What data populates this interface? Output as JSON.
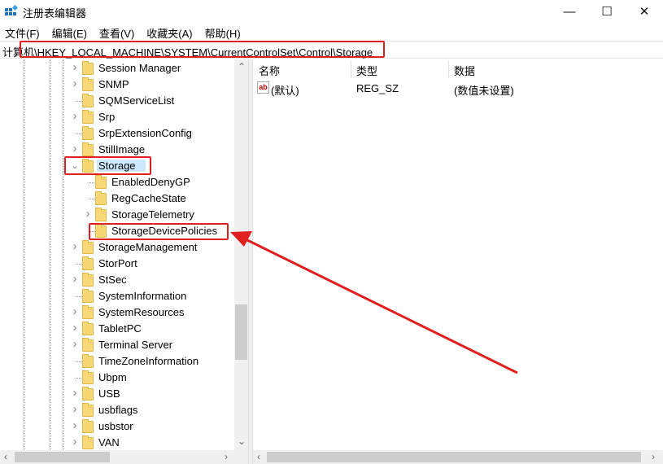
{
  "window": {
    "title": "注册表编辑器",
    "minimize": "—",
    "maximize": "☐",
    "close": "✕"
  },
  "menu": [
    "文件(F)",
    "编辑(E)",
    "查看(V)",
    "收藏夹(A)",
    "帮助(H)"
  ],
  "address": "计算机\\HKEY_LOCAL_MACHINE\\SYSTEM\\CurrentControlSet\\Control\\Storage",
  "tree": [
    {
      "label": "Session Manager",
      "level": 0,
      "chevron": "collapsed"
    },
    {
      "label": "SNMP",
      "level": 0,
      "chevron": "collapsed"
    },
    {
      "label": "SQMServiceList",
      "level": 0,
      "chevron": "none"
    },
    {
      "label": "Srp",
      "level": 0,
      "chevron": "collapsed"
    },
    {
      "label": "SrpExtensionConfig",
      "level": 0,
      "chevron": "none"
    },
    {
      "label": "StillImage",
      "level": 0,
      "chevron": "collapsed"
    },
    {
      "label": "Storage",
      "level": 0,
      "chevron": "expanded",
      "selected": true
    },
    {
      "label": "EnabledDenyGP",
      "level": 1,
      "chevron": "none"
    },
    {
      "label": "RegCacheState",
      "level": 1,
      "chevron": "none"
    },
    {
      "label": "StorageTelemetry",
      "level": 1,
      "chevron": "collapsed"
    },
    {
      "label": "StorageDevicePolicies",
      "level": 1,
      "chevron": "none"
    },
    {
      "label": "StorageManagement",
      "level": 0,
      "chevron": "collapsed"
    },
    {
      "label": "StorPort",
      "level": 0,
      "chevron": "none"
    },
    {
      "label": "StSec",
      "level": 0,
      "chevron": "collapsed"
    },
    {
      "label": "SystemInformation",
      "level": 0,
      "chevron": "none"
    },
    {
      "label": "SystemResources",
      "level": 0,
      "chevron": "collapsed"
    },
    {
      "label": "TabletPC",
      "level": 0,
      "chevron": "collapsed"
    },
    {
      "label": "Terminal Server",
      "level": 0,
      "chevron": "collapsed"
    },
    {
      "label": "TimeZoneInformation",
      "level": 0,
      "chevron": "none"
    },
    {
      "label": "Ubpm",
      "level": 0,
      "chevron": "none"
    },
    {
      "label": "USB",
      "level": 0,
      "chevron": "collapsed"
    },
    {
      "label": "usbflags",
      "level": 0,
      "chevron": "collapsed"
    },
    {
      "label": "usbstor",
      "level": 0,
      "chevron": "collapsed"
    },
    {
      "label": "VAN",
      "level": 0,
      "chevron": "collapsed"
    }
  ],
  "list": {
    "columns": [
      "名称",
      "类型",
      "数据"
    ],
    "rows": [
      {
        "icon": "ab",
        "name": "(默认)",
        "type": "REG_SZ",
        "data": "(数值未设置)"
      }
    ]
  },
  "annotation_color": "#e02020"
}
